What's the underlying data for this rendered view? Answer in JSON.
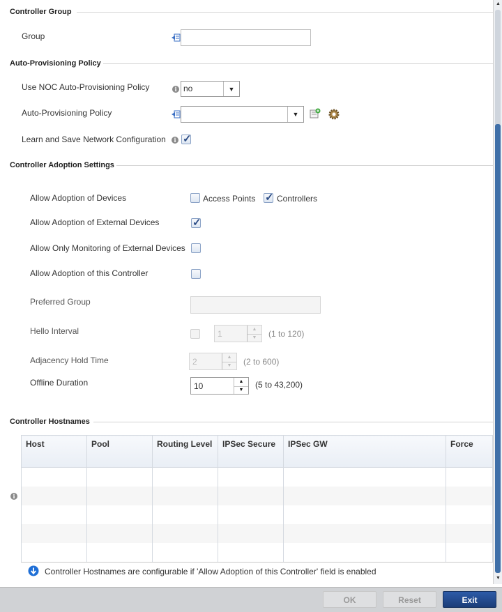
{
  "sections": {
    "controller_group": "Controller Group",
    "auto_provisioning": "Auto-Provisioning Policy",
    "adoption_settings": "Controller Adoption Settings",
    "hostnames": "Controller Hostnames"
  },
  "group": {
    "label": "Group",
    "value": ""
  },
  "use_noc": {
    "label": "Use NOC Auto-Provisioning Policy",
    "value": "no"
  },
  "auto_policy": {
    "label": "Auto-Provisioning Policy",
    "value": ""
  },
  "learn_save": {
    "label": "Learn and Save Network Configuration",
    "checked": true
  },
  "allow_adoption": {
    "label": "Allow Adoption of Devices",
    "access_points_label": "Access Points",
    "access_points_checked": false,
    "controllers_label": "Controllers",
    "controllers_checked": true
  },
  "allow_external": {
    "label": "Allow Adoption of External Devices",
    "checked": true
  },
  "monitor_external": {
    "label": "Allow Only Monitoring of External Devices",
    "checked": false
  },
  "adopt_this": {
    "label": "Allow Adoption of this Controller",
    "checked": false
  },
  "preferred_group": {
    "label": "Preferred Group",
    "value": ""
  },
  "hello_interval": {
    "label": "Hello Interval",
    "value": "1",
    "range": "(1 to 120)"
  },
  "adjacency_hold": {
    "label": "Adjacency Hold Time",
    "value": "2",
    "range": "(2 to 600)"
  },
  "offline_duration": {
    "label": "Offline Duration",
    "value": "10",
    "range": "(5 to 43,200)"
  },
  "table": {
    "columns": [
      "Host",
      "Pool",
      "Routing Level",
      "IPSec Secure",
      "IPSec GW",
      "Force"
    ],
    "row_count": 5
  },
  "note": "Controller Hostnames are configurable if 'Allow Adoption of this Controller' field is enabled",
  "buttons": {
    "ok": "OK",
    "reset": "Reset",
    "exit": "Exit"
  },
  "colors": {
    "accent": "#1b3d78",
    "info_blue": "#1f6fd6"
  }
}
